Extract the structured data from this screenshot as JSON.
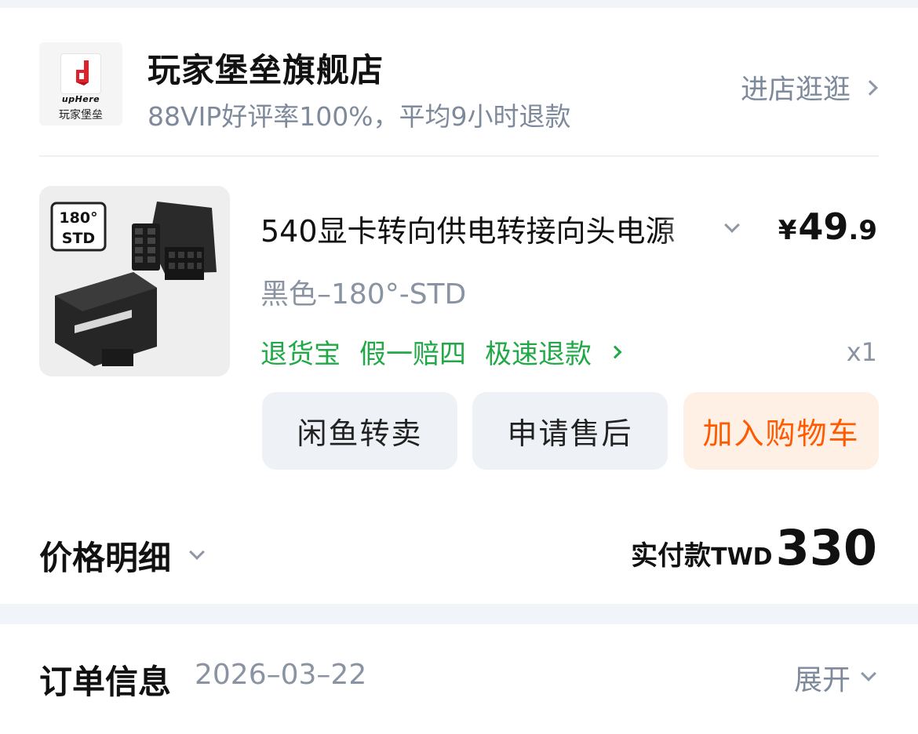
{
  "store": {
    "name": "玩家堡垒旗舰店",
    "subtitle": "88VIP好评率100%，平均9小时退款",
    "visit_label": "进店逛逛",
    "logo_brand": "upHere",
    "logo_sub": "玩家堡垒"
  },
  "product": {
    "image_badge_top": "180°",
    "image_badge_bottom": "STD",
    "title": "540显卡转向供电转接向头电源",
    "price_symbol": "¥",
    "price_int": "49",
    "price_dec": ".9",
    "sku": "黑色–180°-STD",
    "services": [
      "退货宝",
      "假一赔四",
      "极速退款"
    ],
    "quantity": "x1"
  },
  "actions": {
    "resell_label": "闲鱼转卖",
    "after_sale_label": "申请售后",
    "add_cart_label": "加入购物车"
  },
  "payment": {
    "detail_label": "价格明细",
    "paid_label": "实付款",
    "currency": "TWD",
    "amount": "330"
  },
  "order_info": {
    "title": "订单信息",
    "date": "2026–03–22",
    "expand_label": "展开"
  },
  "colors": {
    "accent_green": "#20a946",
    "accent_orange": "#ff5a00",
    "muted": "#8a93a2",
    "page_bg": "#f1f4f8"
  }
}
